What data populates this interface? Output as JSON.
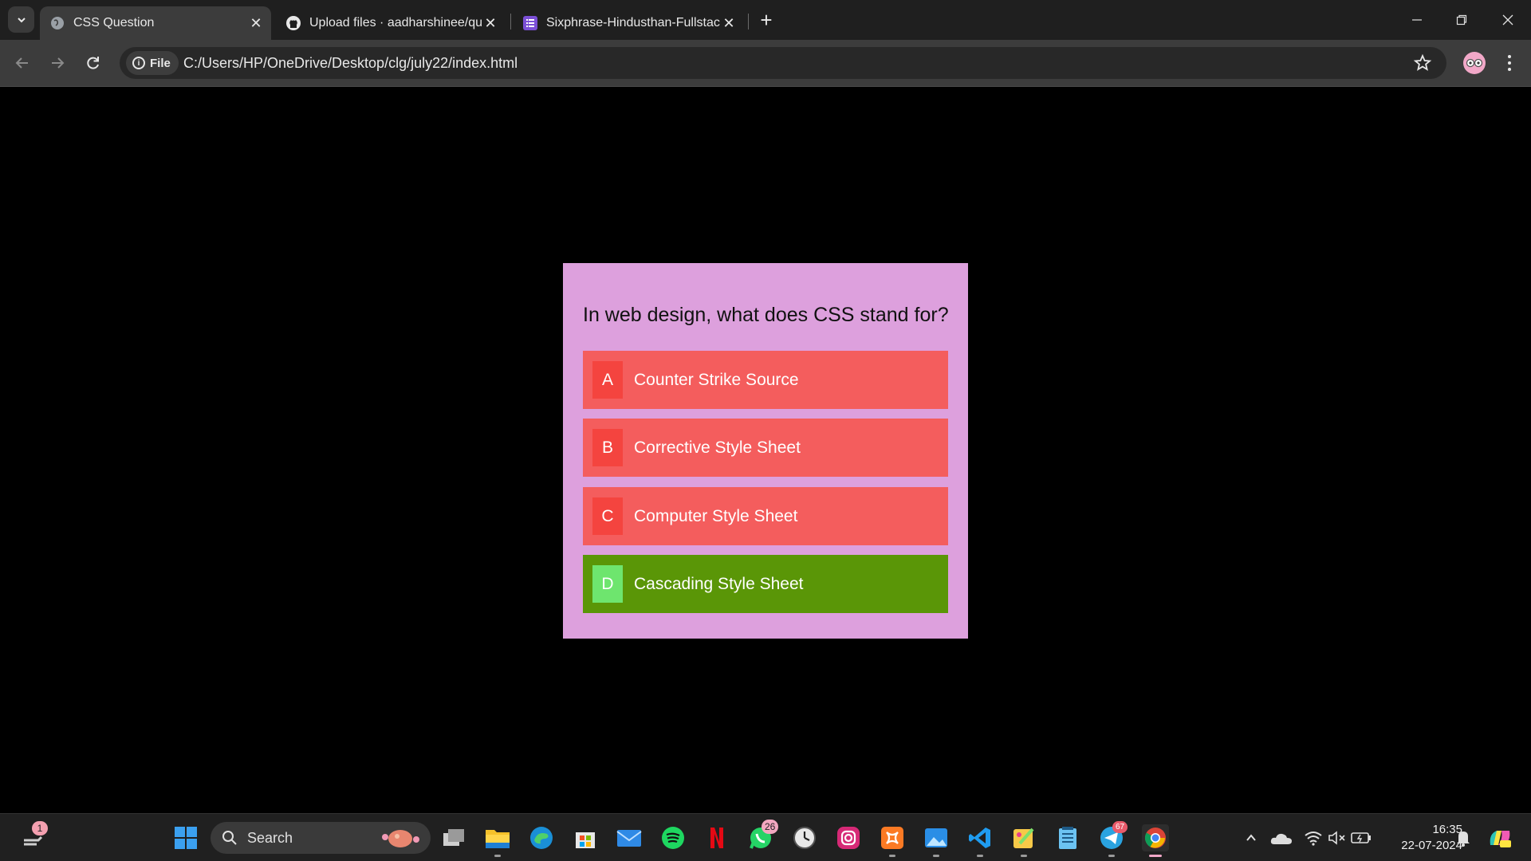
{
  "browser": {
    "tabs": [
      {
        "title": "CSS Question",
        "active": true
      },
      {
        "title": "Upload files · aadharshinee/quiz",
        "active": false
      },
      {
        "title": "Sixphrase-Hindusthan-Fullstack",
        "active": false
      }
    ],
    "address": {
      "chip_label": "File",
      "url": "C:/Users/HP/OneDrive/Desktop/clg/july22/index.html"
    }
  },
  "quiz": {
    "question": "In web design, what does CSS stand for?",
    "options": [
      {
        "letter": "A",
        "text": "Counter Strike Source",
        "state": "incorrect"
      },
      {
        "letter": "B",
        "text": "Corrective Style Sheet",
        "state": "incorrect"
      },
      {
        "letter": "C",
        "text": "Computer Style Sheet",
        "state": "incorrect"
      },
      {
        "letter": "D",
        "text": "Cascading Style Sheet",
        "state": "correct"
      }
    ],
    "colors": {
      "card_bg": "#dda0dd",
      "option_bg": "#f45d5d",
      "letter_bg": "#f4443f",
      "correct_bg": "#5a9607",
      "correct_letter_bg": "#6ee56e"
    }
  },
  "taskbar": {
    "search_label": "Search",
    "notification_badge": "1",
    "whatsapp_badge": "26",
    "telegram_badge": "67",
    "time": "16:35",
    "date": "22-07-2024",
    "icons": [
      "widgets-icon",
      "start-icon",
      "search-icon",
      "task-view-icon",
      "file-explorer-icon",
      "edge-icon",
      "store-icon",
      "mail-icon",
      "spotify-icon",
      "netflix-icon",
      "whatsapp-icon",
      "clock-app-icon",
      "instagram-icon",
      "xampp-icon",
      "photos-icon",
      "vscode-icon",
      "paint-icon",
      "notepad-icon",
      "telegram-icon",
      "chrome-icon"
    ]
  }
}
